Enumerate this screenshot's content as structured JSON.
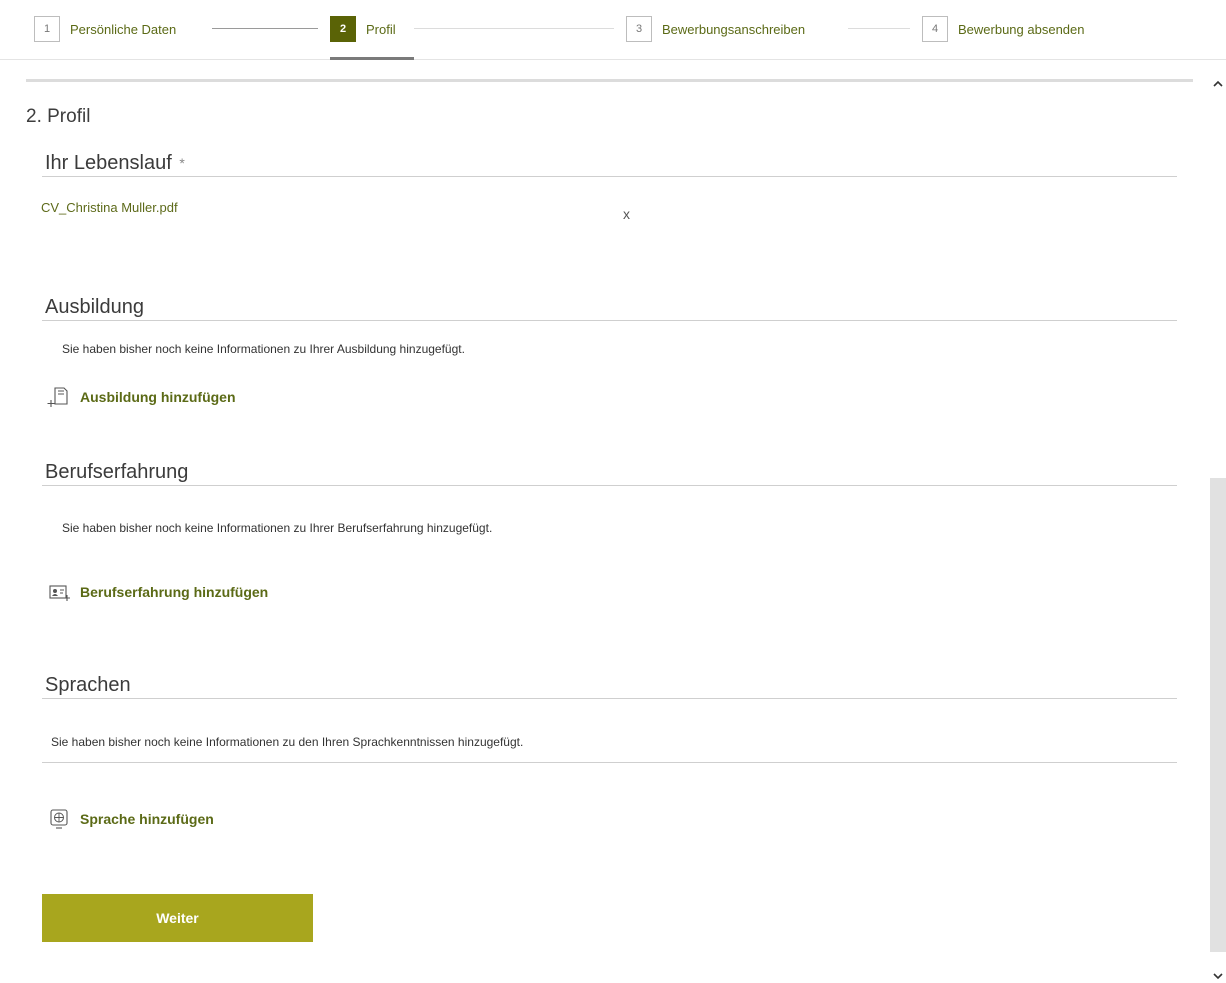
{
  "stepper": {
    "steps": [
      {
        "number": "1",
        "label": "Persönliche Daten"
      },
      {
        "number": "2",
        "label": "Profil"
      },
      {
        "number": "3",
        "label": "Bewerbungsanschreiben"
      },
      {
        "number": "4",
        "label": "Bewerbung absenden"
      }
    ],
    "active_step": "2",
    "accent_color": "#5a6306"
  },
  "page_title": "2. Profil",
  "cv": {
    "title": "Ihr Lebenslauf",
    "required_marker": "*",
    "file_name": "CV_Christina Muller.pdf",
    "remove_label": "x"
  },
  "education": {
    "title": "Ausbildung",
    "empty_text": "Sie haben bisher noch keine Informationen zu Ihrer Ausbildung hinzugefügt.",
    "add_label": "Ausbildung hinzufügen",
    "icon": "document-add-icon"
  },
  "experience": {
    "title": "Berufserfahrung",
    "empty_text": "Sie haben bisher noch keine Informationen zu Ihrer Berufserfahrung hinzugefügt.",
    "add_label": "Berufserfahrung hinzufügen",
    "icon": "id-card-add-icon"
  },
  "languages": {
    "title": "Sprachen",
    "empty_text": "Sie haben bisher noch keine Informationen zu den Ihren Sprachkenntnissen hinzugefügt.",
    "add_label": "Sprache hinzufügen",
    "icon": "globe-icon"
  },
  "actions": {
    "next_label": "Weiter",
    "button_color": "#a8a61e"
  },
  "scrollbar": {
    "up_icon": "^",
    "down_icon": "v"
  }
}
